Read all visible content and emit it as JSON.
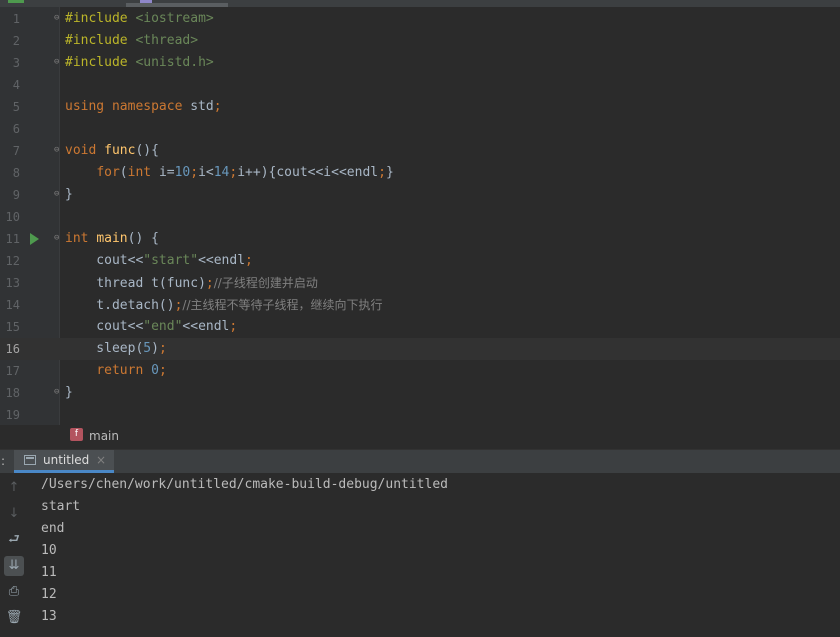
{
  "editor": {
    "current_line": 16,
    "lines": [
      {
        "num": "1",
        "tokens": [
          {
            "t": "#include ",
            "c": "pp"
          },
          {
            "t": "<iostream>",
            "c": "str"
          }
        ]
      },
      {
        "num": "2",
        "tokens": [
          {
            "t": "#include ",
            "c": "pp"
          },
          {
            "t": "<thread>",
            "c": "str"
          }
        ]
      },
      {
        "num": "3",
        "tokens": [
          {
            "t": "#include ",
            "c": "pp"
          },
          {
            "t": "<unistd.h>",
            "c": "str"
          }
        ]
      },
      {
        "num": "4",
        "tokens": []
      },
      {
        "num": "5",
        "tokens": [
          {
            "t": "using namespace ",
            "c": "kw"
          },
          {
            "t": "std",
            "c": "plain"
          },
          {
            "t": ";",
            "c": "kw"
          }
        ]
      },
      {
        "num": "6",
        "tokens": []
      },
      {
        "num": "7",
        "tokens": [
          {
            "t": "void ",
            "c": "kw"
          },
          {
            "t": "func",
            "c": "fn"
          },
          {
            "t": "(){",
            "c": "plain"
          }
        ]
      },
      {
        "num": "8",
        "tokens": [
          {
            "t": "    ",
            "c": "plain"
          },
          {
            "t": "for",
            "c": "kw"
          },
          {
            "t": "(",
            "c": "plain"
          },
          {
            "t": "int ",
            "c": "kw"
          },
          {
            "t": "i=",
            "c": "plain"
          },
          {
            "t": "10",
            "c": "num"
          },
          {
            "t": ";",
            "c": "kw"
          },
          {
            "t": "i<",
            "c": "plain"
          },
          {
            "t": "14",
            "c": "num"
          },
          {
            "t": ";",
            "c": "kw"
          },
          {
            "t": "i++){cout<<i<<endl",
            "c": "plain"
          },
          {
            "t": ";",
            "c": "kw"
          },
          {
            "t": "}",
            "c": "plain"
          }
        ]
      },
      {
        "num": "9",
        "tokens": [
          {
            "t": "}",
            "c": "plain"
          }
        ]
      },
      {
        "num": "10",
        "tokens": []
      },
      {
        "num": "11",
        "tokens": [
          {
            "t": "int ",
            "c": "kw"
          },
          {
            "t": "main",
            "c": "fn"
          },
          {
            "t": "() {",
            "c": "plain"
          }
        ]
      },
      {
        "num": "12",
        "tokens": [
          {
            "t": "    cout<<",
            "c": "plain"
          },
          {
            "t": "\"start\"",
            "c": "str"
          },
          {
            "t": "<<endl",
            "c": "plain"
          },
          {
            "t": ";",
            "c": "kw"
          }
        ]
      },
      {
        "num": "13",
        "tokens": [
          {
            "t": "    ",
            "c": "plain"
          },
          {
            "t": "thread ",
            "c": "plain"
          },
          {
            "t": "t(func)",
            "c": "plain"
          },
          {
            "t": ";",
            "c": "kw"
          },
          {
            "t": "//子线程创建并启动",
            "c": "cm"
          }
        ]
      },
      {
        "num": "14",
        "tokens": [
          {
            "t": "    t.detach()",
            "c": "plain"
          },
          {
            "t": ";",
            "c": "kw"
          },
          {
            "t": "//主线程不等待子线程，继续向下执行",
            "c": "cm"
          }
        ]
      },
      {
        "num": "15",
        "tokens": [
          {
            "t": "    cout<<",
            "c": "plain"
          },
          {
            "t": "\"end\"",
            "c": "str"
          },
          {
            "t": "<<endl",
            "c": "plain"
          },
          {
            "t": ";",
            "c": "kw"
          }
        ]
      },
      {
        "num": "16",
        "tokens": [
          {
            "t": "    sleep(",
            "c": "plain"
          },
          {
            "t": "5",
            "c": "num"
          },
          {
            "t": ")",
            "c": "plain"
          },
          {
            "t": ";",
            "c": "kw"
          }
        ]
      },
      {
        "num": "17",
        "tokens": [
          {
            "t": "    ",
            "c": "plain"
          },
          {
            "t": "return ",
            "c": "kw"
          },
          {
            "t": "0",
            "c": "num"
          },
          {
            "t": ";",
            "c": "kw"
          }
        ]
      },
      {
        "num": "18",
        "tokens": [
          {
            "t": "}",
            "c": "plain"
          }
        ]
      },
      {
        "num": "19",
        "tokens": []
      }
    ]
  },
  "breadcrumb": {
    "icon_letter": "f",
    "label": "main"
  },
  "run_panel": {
    "prefix": ":",
    "tab_label": "untitled",
    "close_glyph": "×",
    "output": [
      "/Users/chen/work/untitled/cmake-build-debug/untitled",
      "start",
      "end",
      "10",
      "11",
      "12",
      "13"
    ]
  },
  "colors": {
    "keyword": "#cc7832",
    "preprocessor": "#bbb529",
    "function": "#ffc66d",
    "number": "#6897bb",
    "string": "#6a8759",
    "comment": "#808080",
    "run_arrow": "#4e9a4e",
    "tab_underline": "#4a88c7"
  }
}
